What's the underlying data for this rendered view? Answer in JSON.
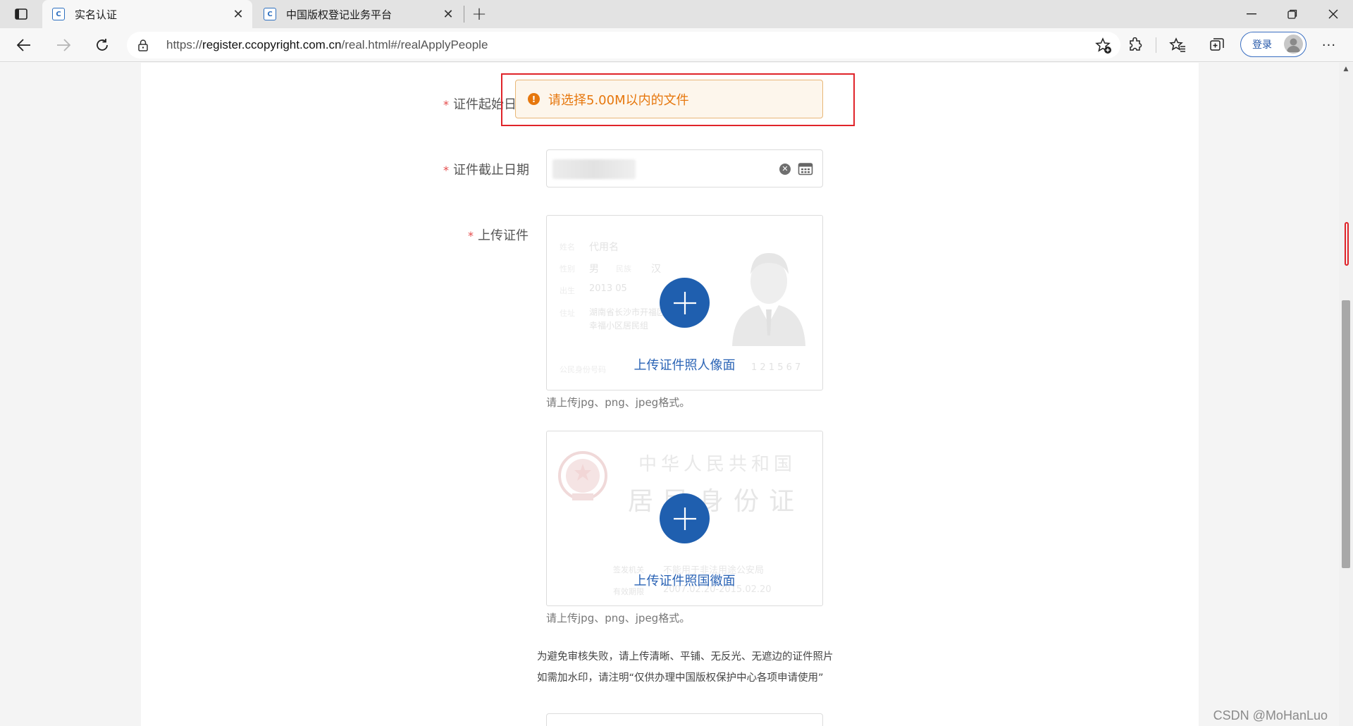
{
  "browser": {
    "tabs": [
      {
        "title": "实名认证",
        "favicon": "C",
        "active": true
      },
      {
        "title": "中国版权登记业务平台",
        "favicon": "C",
        "active": false
      }
    ],
    "new_tab_label": "+",
    "url": {
      "scheme": "https://",
      "host": "register.ccopyright.com.cn",
      "path": "/real.html#/realApplyPeople"
    },
    "login_label": "登录",
    "more_label": "···"
  },
  "form": {
    "start_date_label": "证件起始日",
    "end_date_label": "证件截止日期",
    "upload_label": "上传证件",
    "required_mark": "*",
    "front_upload_text": "上传证件照人像面",
    "back_upload_text": "上传证件照国徽面",
    "format_hint": "请上传jpg、png、jpeg格式。",
    "notice_line1": "为避免审核失败，请上传清晰、平铺、无反光、无遮边的证件照片",
    "notice_line2": "如需加水印，请注明“仅供办理中国版权保护中心各项申请使用”"
  },
  "id_front_watermark": {
    "name_label": "姓名",
    "name_value": "代用名",
    "sex_label": "性别",
    "sex_value": "男",
    "ethnic_label": "民族",
    "ethnic_value": "汉",
    "birth_label": "出生",
    "birth_value": "2013    05",
    "address_label": "住址",
    "address_line1": "湖南省长沙市开福区",
    "address_line2": "幸福小区居民组",
    "id_label": "公民身份号码",
    "id_value": "1 2 1 5 6 7"
  },
  "id_back_watermark": {
    "country": "中华人民共和国",
    "card_type": "居民身份证",
    "issuer_label": "签发机关",
    "issuer_value": "不能用于非法用途公安局",
    "validity_label": "有效期限",
    "validity_value": "2007.02.20-2015.02.20"
  },
  "toast": {
    "message": "请选择5.00M以内的文件",
    "type": "warning",
    "color": "#e6770d"
  },
  "watermark": "CSDN @MoHanLuo",
  "colors": {
    "accent": "#1f5faf",
    "highlight": "#e0242a",
    "required": "#e54b4b"
  }
}
